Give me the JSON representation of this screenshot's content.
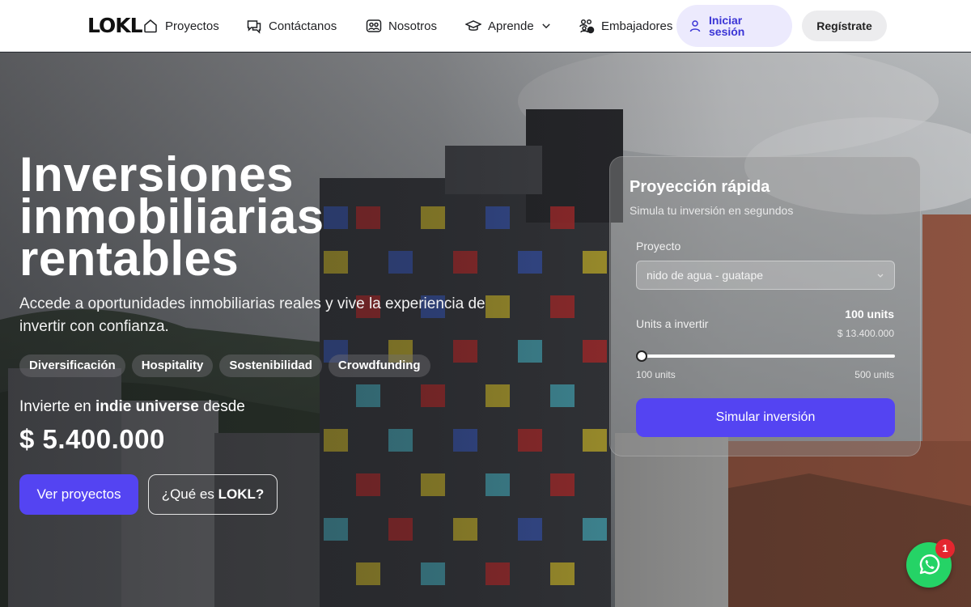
{
  "nav": {
    "logo": "LOKL",
    "items": [
      {
        "label": "Proyectos",
        "icon": "home-icon"
      },
      {
        "label": "Contáctanos",
        "icon": "chat-icon"
      },
      {
        "label": "Nosotros",
        "icon": "users-icon"
      },
      {
        "label": "Aprende",
        "icon": "graduation-cap-icon"
      },
      {
        "label": "Embajadores",
        "icon": "ambassadors-icon"
      }
    ],
    "login_label": "Iniciar sesión",
    "register_label": "Regístrate"
  },
  "hero": {
    "title_lines": [
      "Inversiones",
      "inmobiliarias",
      "rentables"
    ],
    "subtitle": "Accede a oportunidades inmobiliarias reales y vive la experiencia de invertir con confianza.",
    "chips": [
      "Diversificación",
      "Hospitality",
      "Sostenibilidad",
      "Crowdfunding"
    ],
    "invest_prefix": "Invierte en",
    "invest_project": "indie universe",
    "invest_suffix": "desde",
    "price": "$ 5.400.000",
    "cta_projects": "Ver proyectos",
    "cta_what_prefix": "¿Qué es",
    "cta_what_brand": "LOKL",
    "cta_what_suffix": "?"
  },
  "simulator": {
    "title": "Proyección rápida",
    "subtitle": "Simula tu inversión en segundos",
    "project_label": "Proyecto",
    "project_selected": "nido de agua - guatape",
    "units_label": "Units a invertir",
    "units_value": "100 units",
    "units_amount": "$ 13.400.000",
    "range_min": "100 units",
    "range_max": "500 units",
    "slider_fraction": 0.0,
    "submit_label": "Simular inversión"
  },
  "whatsapp": {
    "badge": "1"
  },
  "colors": {
    "primary": "#5444f2",
    "login_bg": "#eceafd",
    "login_text": "#3b35d6",
    "whatsapp": "#25d366",
    "badge": "#e4262f"
  }
}
